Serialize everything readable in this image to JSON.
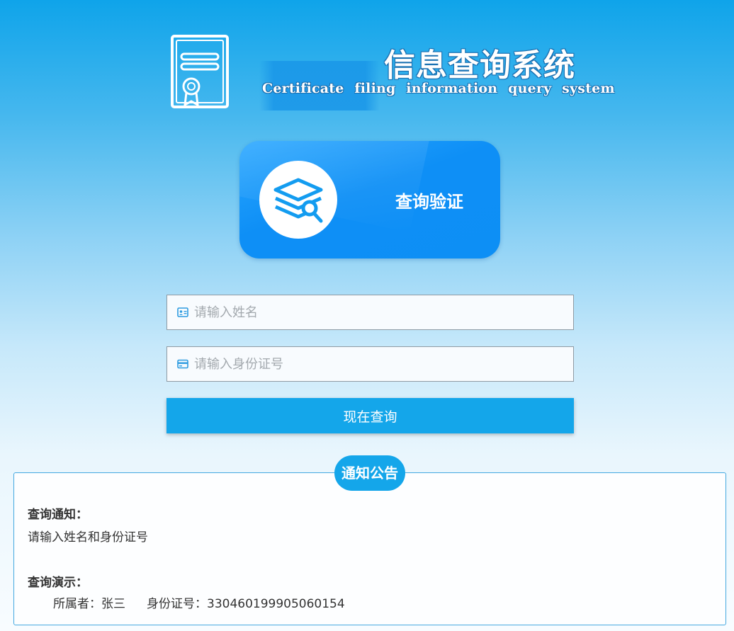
{
  "header": {
    "title_cn": "信息查询系统",
    "title_en": "Certificate filing information query system",
    "logo_icon": "certificate-icon"
  },
  "verify_card": {
    "label": "查询验证",
    "icon": "layers-search-icon"
  },
  "form": {
    "name_placeholder": "请输入姓名",
    "name_value": "",
    "id_placeholder": "请输入身份证号",
    "id_value": "",
    "submit_label": "现在查询"
  },
  "notice": {
    "badge": "通知公告",
    "heading_1": "查询通知：",
    "text_1": "请输入姓名和身份证号",
    "heading_2": "查询演示：",
    "demo_owner_label": "所属者：",
    "demo_owner_value": "张三",
    "demo_id_label": "身份证号：",
    "demo_id_value": "330460199905060154"
  },
  "colors": {
    "accent": "#14a6ea",
    "card": "#0e8ff6",
    "border": "#44a8e0"
  }
}
